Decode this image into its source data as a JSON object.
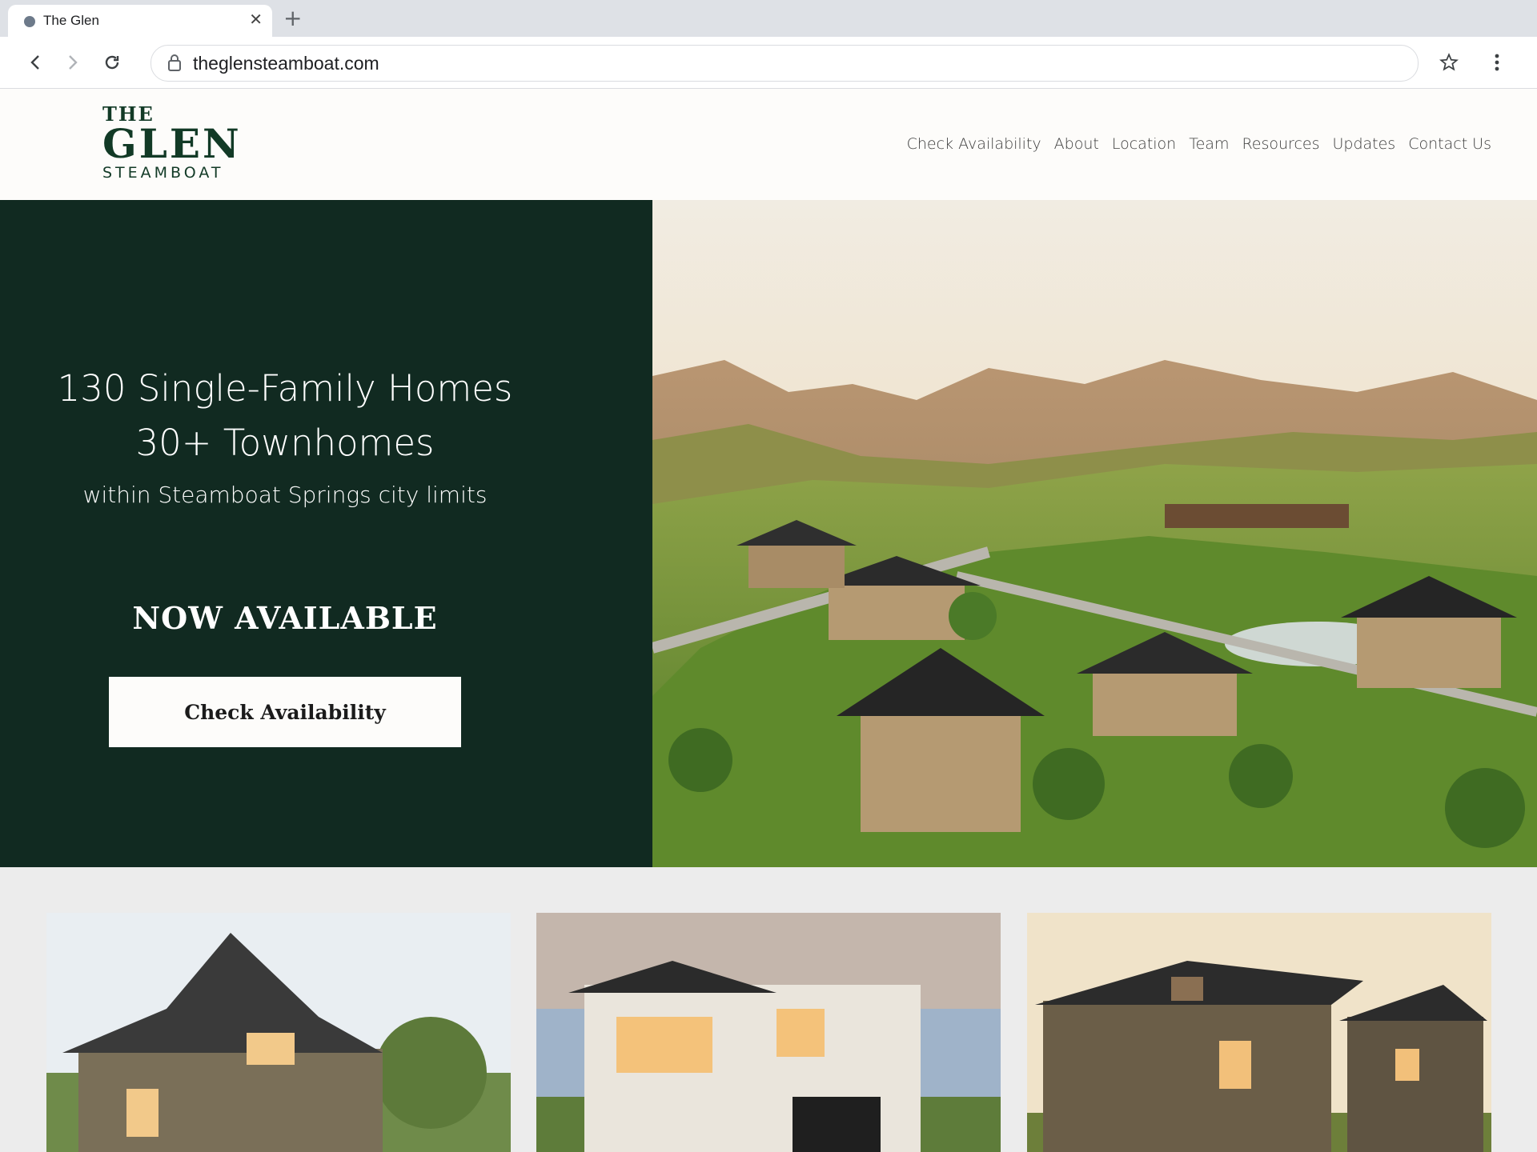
{
  "browser": {
    "tab_title": "The Glen",
    "url": "theglensteamboat.com"
  },
  "logo": {
    "the": "THE",
    "glen": "GLEN",
    "steamboat": "STEAMBOAT"
  },
  "nav": {
    "items": [
      "Check Availability",
      "About",
      "Location",
      "Team",
      "Resources",
      "Updates",
      "Contact Us"
    ]
  },
  "hero": {
    "line1": "130 Single-Family Homes",
    "line2": "30+ Townhomes",
    "line3": "within Steamboat Springs city limits",
    "headline": "NOW AVAILABLE",
    "cta_label": "Check Availability"
  },
  "colors": {
    "brand_green": "#112a21",
    "logo_green": "#123a26",
    "header_bg": "#fdfcfa",
    "section_bg": "#ececec"
  }
}
